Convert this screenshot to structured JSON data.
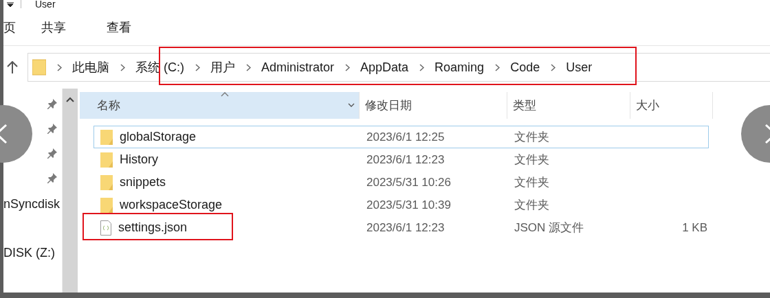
{
  "window": {
    "title": "User"
  },
  "ribbon_tabs": [
    {
      "label": "页"
    },
    {
      "label": "共享"
    },
    {
      "label": "查看"
    }
  ],
  "address_bar": {
    "highlighted": true,
    "segments": [
      "此电脑",
      "系统 (C:)",
      "用户",
      "Administrator",
      "AppData",
      "Roaming",
      "Code",
      "User"
    ]
  },
  "nav_pane": {
    "items": [
      "nSyncdisk",
      "DISK (Z:)"
    ]
  },
  "columns": [
    {
      "label": "名称",
      "sorted": true
    },
    {
      "label": "修改日期",
      "sorted": false
    },
    {
      "label": "类型",
      "sorted": false
    },
    {
      "label": "大小",
      "sorted": false
    }
  ],
  "rows": [
    {
      "name": "globalStorage",
      "kind": "folder",
      "modified": "2023/6/1 12:25",
      "type": "文件夹",
      "size": "",
      "focused": true,
      "highlighted": false
    },
    {
      "name": "History",
      "kind": "folder",
      "modified": "2023/6/1 12:23",
      "type": "文件夹",
      "size": "",
      "focused": false,
      "highlighted": false
    },
    {
      "name": "snippets",
      "kind": "folder",
      "modified": "2023/5/31 10:26",
      "type": "文件夹",
      "size": "",
      "focused": false,
      "highlighted": false
    },
    {
      "name": "workspaceStorage",
      "kind": "folder",
      "modified": "2023/5/31 10:39",
      "type": "文件夹",
      "size": "",
      "focused": false,
      "highlighted": false
    },
    {
      "name": "settings.json",
      "kind": "json",
      "modified": "2023/6/1 12:23",
      "type": "JSON 源文件",
      "size": "1 KB",
      "focused": false,
      "highlighted": true
    }
  ]
}
